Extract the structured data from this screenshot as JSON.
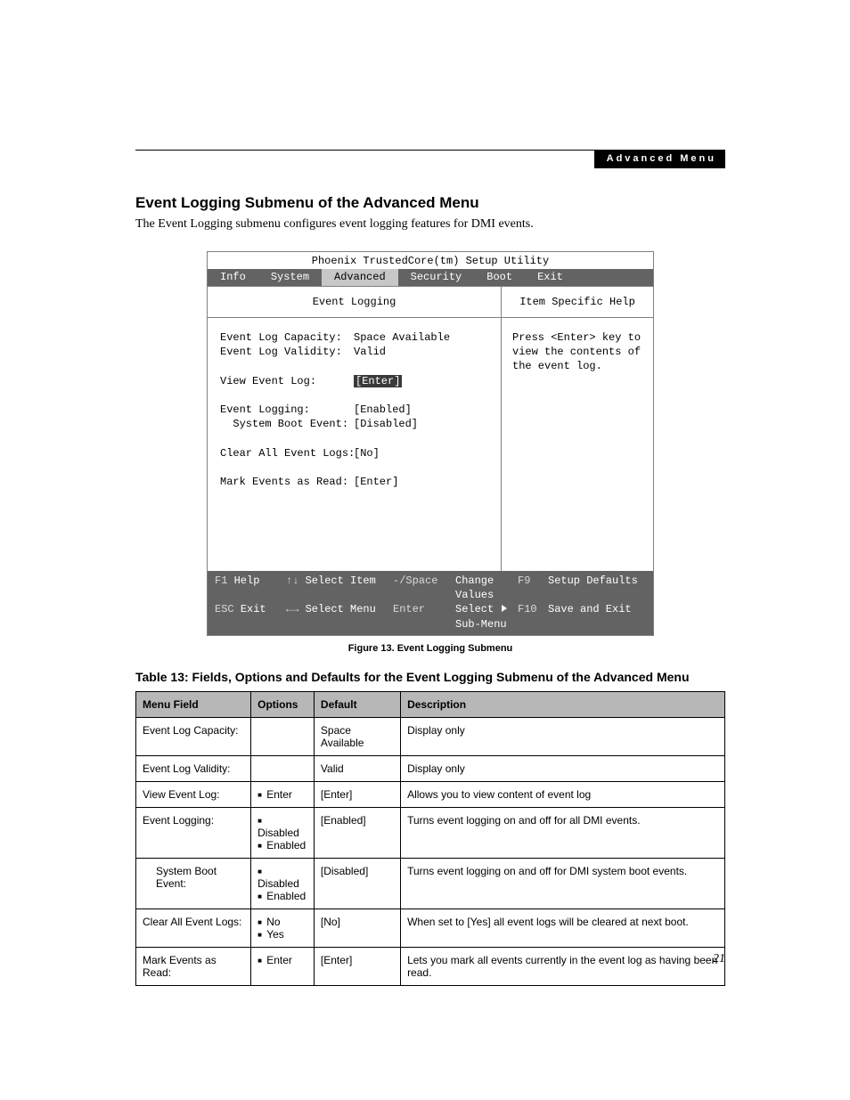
{
  "header_tag": "Advanced Menu",
  "section_title": "Event Logging Submenu of the Advanced Menu",
  "intro": "The Event Logging submenu configures event logging features for DMI events.",
  "bios": {
    "utility_title": "Phoenix TrustedCore(tm) Setup Utility",
    "tabs": [
      "Info",
      "System",
      "Advanced",
      "Security",
      "Boot",
      "Exit"
    ],
    "active_tab": "Advanced",
    "subhead_left": "Event Logging",
    "subhead_right": "Item Specific Help",
    "help_text": "Press <Enter> key to view the contents of the event log.",
    "rows": [
      {
        "label": "Event Log Capacity:",
        "value": "Space Available",
        "selected": false,
        "indent": 0
      },
      {
        "label": "Event Log Validity:",
        "value": "Valid",
        "selected": false,
        "indent": 0
      },
      {
        "label": "",
        "value": "",
        "selected": false,
        "indent": 0
      },
      {
        "label": "View Event Log:",
        "value": "[Enter]",
        "selected": true,
        "indent": 0
      },
      {
        "label": "",
        "value": "",
        "selected": false,
        "indent": 0
      },
      {
        "label": "Event Logging:",
        "value": "[Enabled]",
        "selected": false,
        "indent": 0
      },
      {
        "label": "System Boot Event:",
        "value": "[Disabled]",
        "selected": false,
        "indent": 1
      },
      {
        "label": "",
        "value": "",
        "selected": false,
        "indent": 0
      },
      {
        "label": "Clear All Event Logs:",
        "value": "[No]",
        "selected": false,
        "indent": 0
      },
      {
        "label": "",
        "value": "",
        "selected": false,
        "indent": 0
      },
      {
        "label": "Mark Events as Read:",
        "value": "[Enter]",
        "selected": false,
        "indent": 0
      }
    ],
    "footer": {
      "r1": {
        "k1": "F1",
        "a1": "Help",
        "k2": "↑↓",
        "a2": "Select Item",
        "k3": "-/Space",
        "a3": "Change Values",
        "k4": "F9",
        "a4": "Setup Defaults"
      },
      "r2": {
        "k1": "ESC",
        "a1": "Exit",
        "k2": "←→",
        "a2": "Select Menu",
        "k3": "Enter",
        "a3": "Select   Sub-Menu",
        "k4": "F10",
        "a4": "Save and Exit"
      }
    }
  },
  "figure_caption": "Figure 13.  Event Logging Submenu",
  "table_title": "Table 13: Fields, Options and Defaults for the Event Logging Submenu of the Advanced Menu",
  "table": {
    "headers": [
      "Menu Field",
      "Options",
      "Default",
      "Description"
    ],
    "rows": [
      {
        "field": "Event Log Capacity:",
        "options": [],
        "default": "Space Available",
        "desc": "Display only",
        "indent": false
      },
      {
        "field": "Event Log Validity:",
        "options": [],
        "default": "Valid",
        "desc": "Display only",
        "indent": false
      },
      {
        "field": "View Event Log:",
        "options": [
          "Enter"
        ],
        "default": "[Enter]",
        "desc": "Allows you to view content of event log",
        "indent": false
      },
      {
        "field": "Event Logging:",
        "options": [
          "Disabled",
          "Enabled"
        ],
        "default": "[Enabled]",
        "desc": "Turns event logging on and off for all DMI events.",
        "indent": false
      },
      {
        "field": "System Boot Event:",
        "options": [
          "Disabled",
          "Enabled"
        ],
        "default": "[Disabled]",
        "desc": "Turns event logging on and off for DMI system boot events.",
        "indent": true
      },
      {
        "field": "Clear All Event Logs:",
        "options": [
          "No",
          "Yes"
        ],
        "default": "[No]",
        "desc": "When set to [Yes] all event logs will be cleared at next boot.",
        "indent": false
      },
      {
        "field": "Mark Events as Read:",
        "options": [
          "Enter"
        ],
        "default": "[Enter]",
        "desc": "Lets you mark all events currently in the event log as having been read.",
        "indent": false
      }
    ]
  },
  "page_number": "21"
}
